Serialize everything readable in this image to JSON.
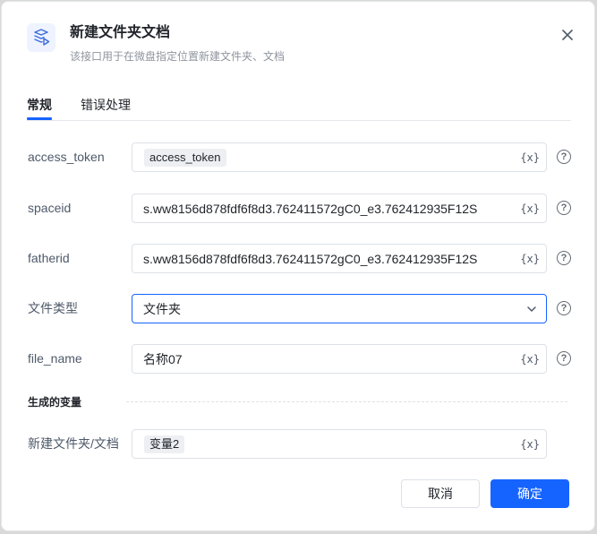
{
  "dialog": {
    "title": "新建文件夹文档",
    "subtitle": "该接口用于在微盘指定位置新建文件夹、文档",
    "icon": "folder-document-icon"
  },
  "tabs": [
    {
      "label": "常规",
      "active": true
    },
    {
      "label": "错误处理",
      "active": false
    }
  ],
  "fields": {
    "access_token": {
      "label": "access_token",
      "chip": "access_token",
      "var_icon": "{x}"
    },
    "spaceid": {
      "label": "spaceid",
      "value": "s.ww8156d878fdf6f8d3.762411572gC0_e3.762412935F12S",
      "var_icon": "{x}"
    },
    "fatherid": {
      "label": "fatherid",
      "value": "s.ww8156d878fdf6f8d3.762411572gC0_e3.762412935F12S",
      "var_icon": "{x}"
    },
    "file_type": {
      "label": "文件类型",
      "value": "文件夹"
    },
    "file_name": {
      "label": "file_name",
      "value": "名称07",
      "var_icon": "{x}"
    }
  },
  "output_section": {
    "title": "生成的变量"
  },
  "output": {
    "label": "新建文件夹/文档",
    "chip": "变量2",
    "var_icon": "{x}"
  },
  "help_symbol": "?",
  "footer": {
    "cancel_label": "取消",
    "ok_label": "确定"
  },
  "colors": {
    "accent": "#1664ff",
    "text": "#1f2329",
    "muted": "#8f959e"
  }
}
